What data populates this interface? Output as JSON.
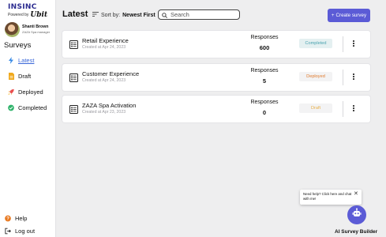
{
  "brand": {
    "name": "INSINC",
    "powered_by": "Powered by",
    "script_mark": "Ubit"
  },
  "user": {
    "name": "Shanti Brown",
    "role": "ZAZA Spa manager"
  },
  "sidebar": {
    "heading": "Surveys",
    "items": [
      {
        "label": "Latest",
        "icon": "lightning-icon",
        "active": true
      },
      {
        "label": "Draft",
        "icon": "draft-document-icon"
      },
      {
        "label": "Deployed",
        "icon": "rocket-icon"
      },
      {
        "label": "Completed",
        "icon": "check-circle-icon"
      }
    ],
    "bottom": [
      {
        "label": "Help",
        "icon": "question-circle-icon"
      },
      {
        "label": "Log out",
        "icon": "logout-icon"
      }
    ]
  },
  "header": {
    "title": "Latest",
    "sort_prefix": "Sort by:",
    "sort_value": "Newest First",
    "search_placeholder": "Search",
    "create_label": "Create survey"
  },
  "surveys": [
    {
      "title": "Retail Experience",
      "date": "Created at Apr 24, 2023",
      "responses_label": "Responses",
      "responses": "600",
      "status": "Completed"
    },
    {
      "title": "Customer Experience",
      "date": "Created at Apr 24, 2023",
      "responses_label": "Responses",
      "responses": "5",
      "status": "Deployed"
    },
    {
      "title": "ZAZA Spa Activation",
      "date": "Created at Apr 23, 2023",
      "responses_label": "Responses",
      "responses": "0",
      "status": "Draft"
    }
  ],
  "status_colors": {
    "Completed": {
      "bg": "#e4f0f1",
      "fg": "#4aa3b0"
    },
    "Deployed": {
      "bg": "#f3f3f4",
      "fg": "#e07a2c"
    },
    "Draft": {
      "bg": "#f3f3f4",
      "fg": "#e8b04a"
    }
  },
  "assistant": {
    "bubble": "Need help? Click here and chat with me!",
    "label": "AI Survey Builder"
  },
  "colors": {
    "accent": "#5b5bd6",
    "active_link": "#3a67d8",
    "background": "#eeeeef"
  }
}
